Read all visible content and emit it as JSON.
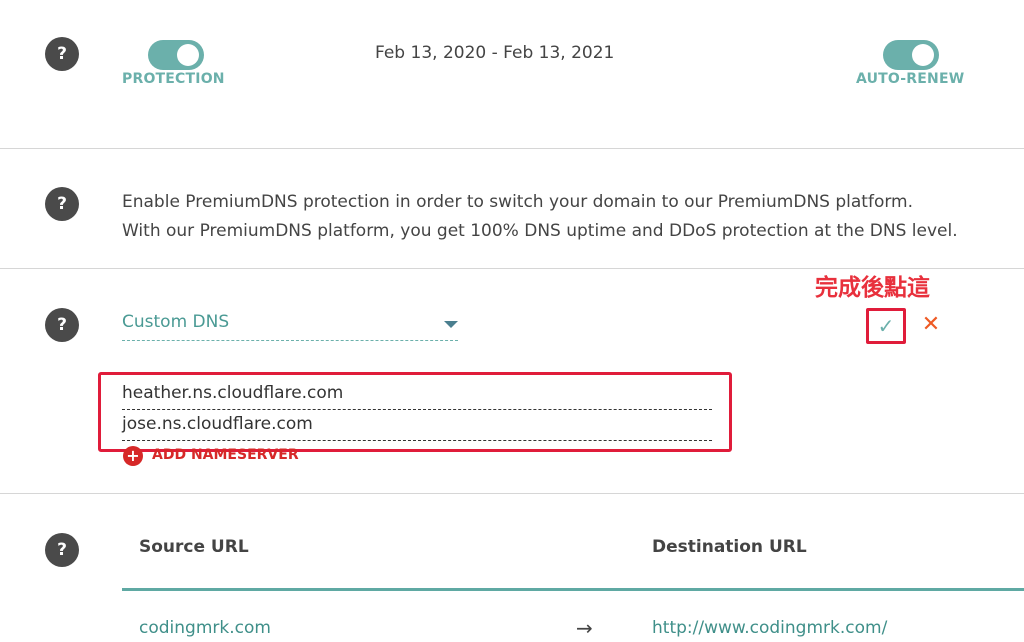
{
  "protection": {
    "help_icon": "?",
    "protection_label": "PROTECTION",
    "protection_on": true,
    "date_range": "Feb 13, 2020 - Feb 13, 2021",
    "auto_renew_label": "AUTO-RENEW",
    "auto_renew_on": true
  },
  "premium_dns": {
    "help_icon": "?",
    "line1": "Enable PremiumDNS protection in order to switch your domain to our PremiumDNS platform.",
    "line2": "With our PremiumDNS platform, you get 100% DNS uptime and DDoS protection at the DNS level."
  },
  "nameservers": {
    "help_icon": "?",
    "select_value": "Custom DNS",
    "annotation": "完成後點這",
    "confirm_icon": "✓",
    "cancel_icon": "✕",
    "fields": [
      {
        "value": "heather.ns.cloudflare.com"
      },
      {
        "value": "jose.ns.cloudflare.com"
      }
    ],
    "add_icon": "+",
    "add_label": "ADD NAMESERVER"
  },
  "redirects": {
    "help_icon": "?",
    "source_header": "Source URL",
    "destination_header": "Destination URL",
    "rows": [
      {
        "source": "codingmrk.com",
        "arrow": "→",
        "destination": "http://www.codingmrk.com/"
      }
    ]
  },
  "colors": {
    "accent": "#6bb0ab",
    "highlight": "#e01c3a",
    "danger": "#d62828"
  }
}
